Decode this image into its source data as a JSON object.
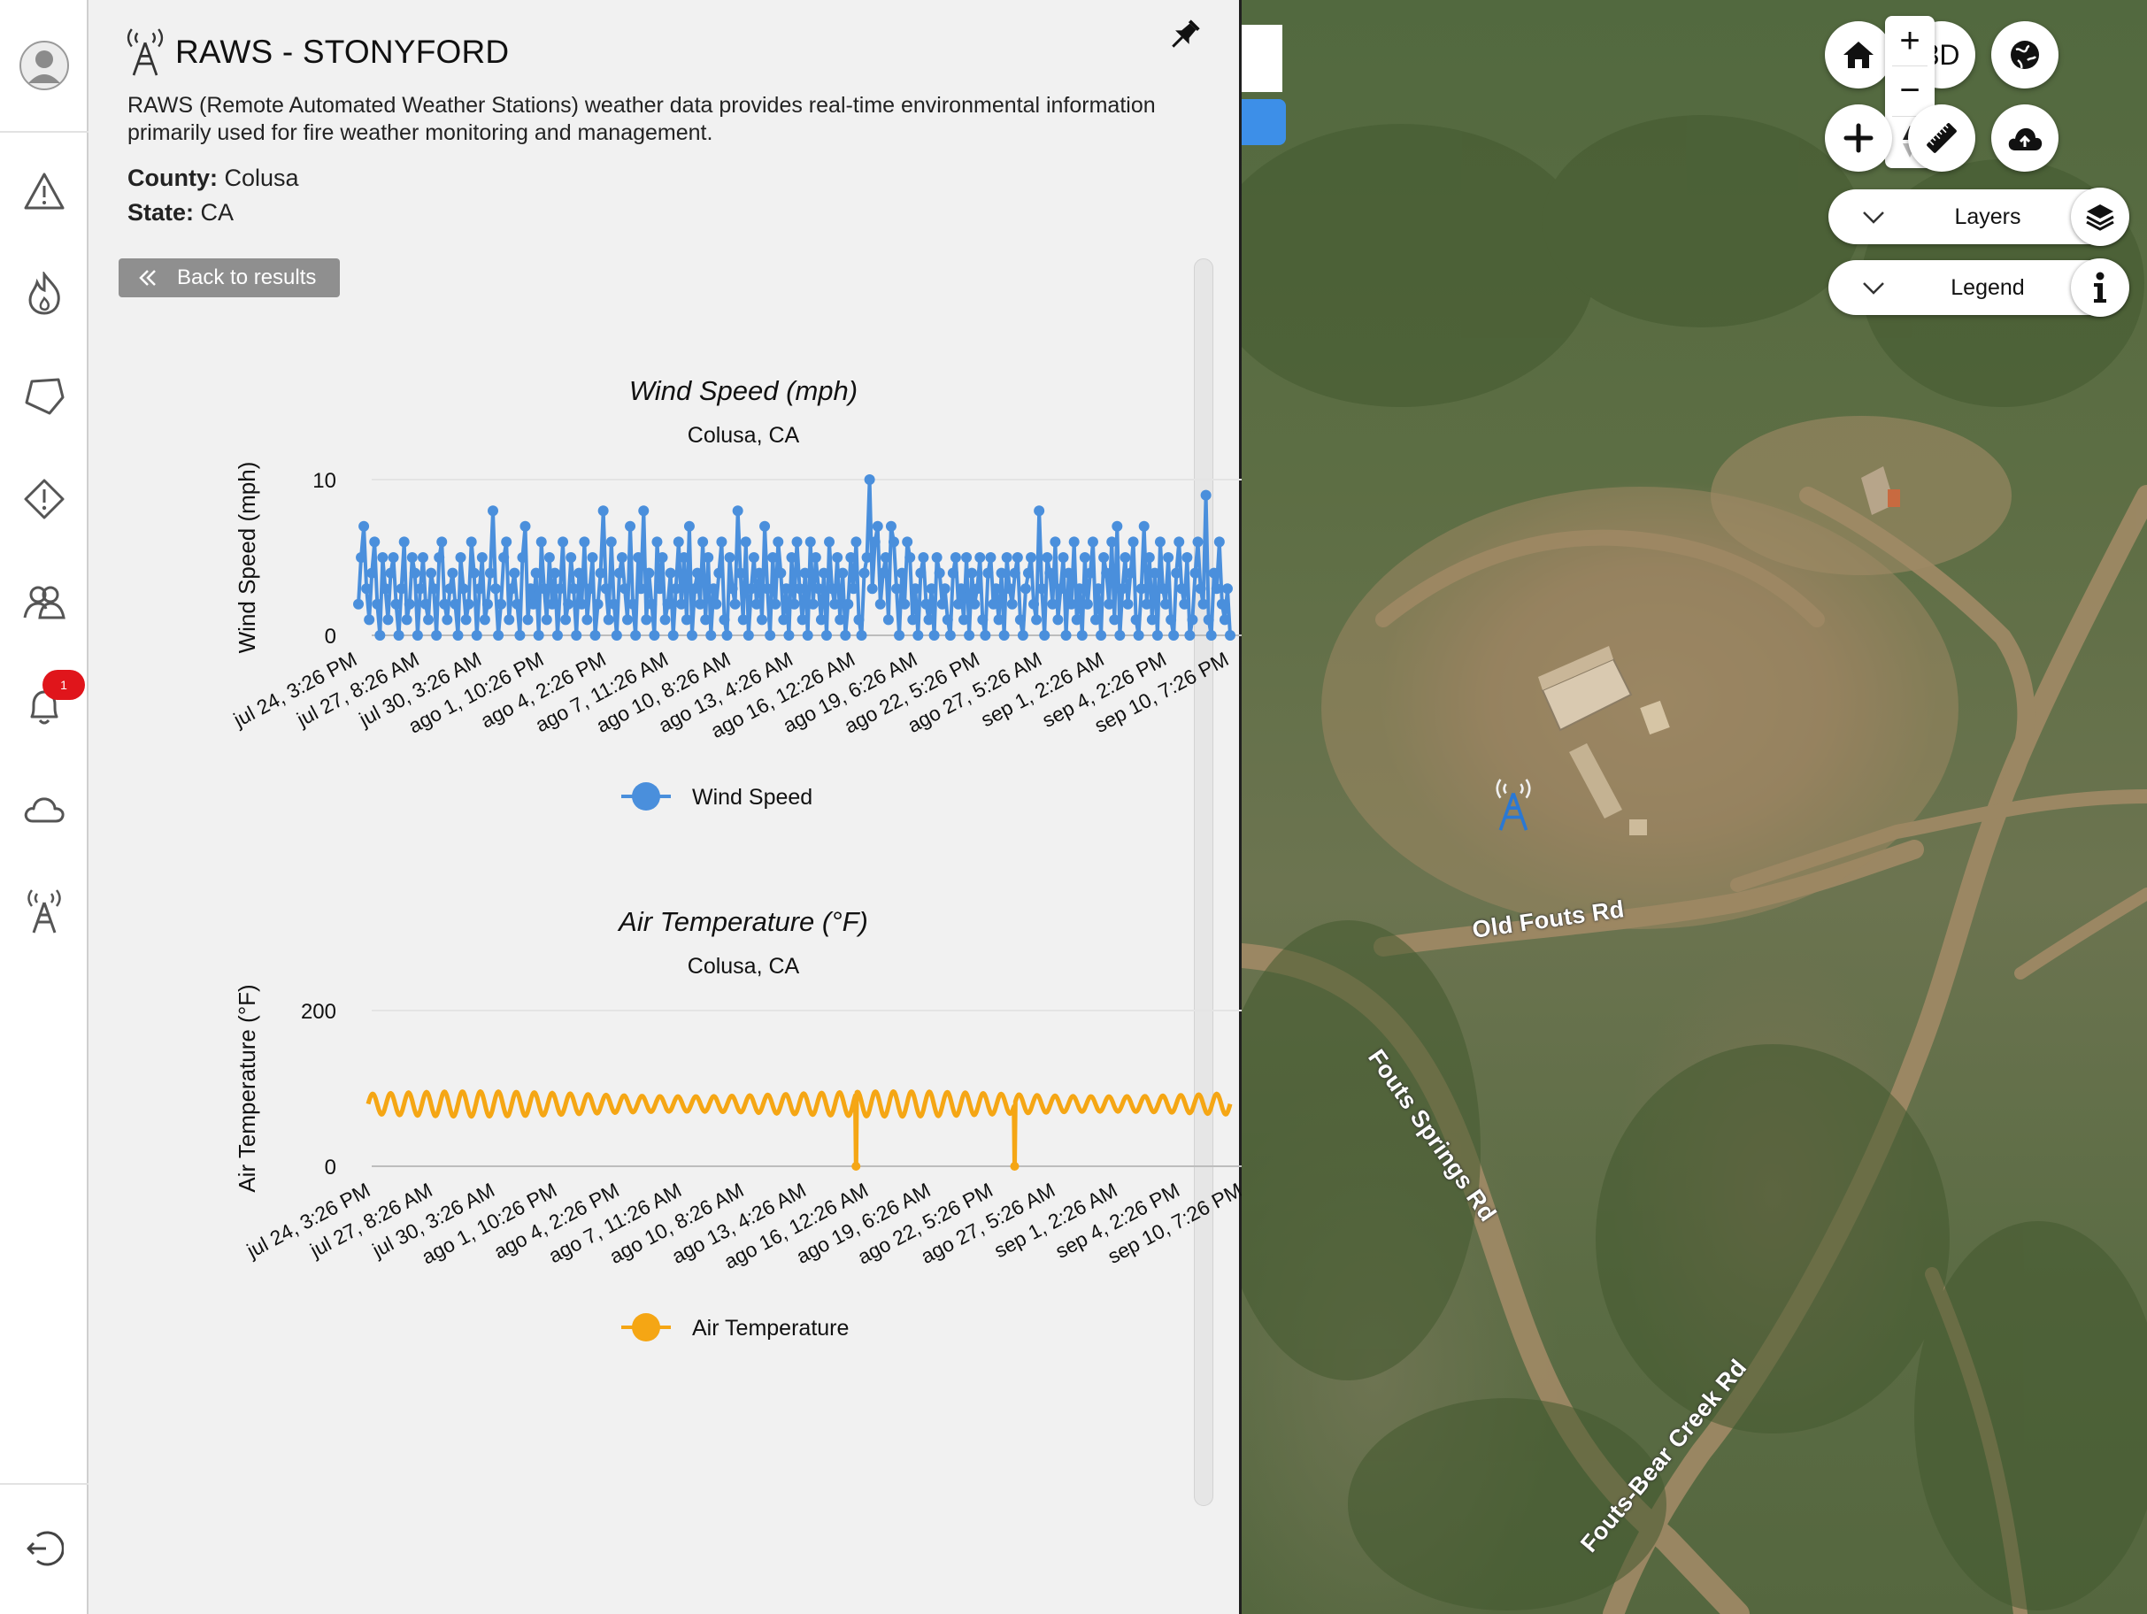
{
  "station": {
    "title": "RAWS - STONYFORD",
    "description": "RAWS (Remote Automated Weather Stations) weather data provides real-time environmental information primarily used for fire weather monitoring and management.",
    "county_label": "County:",
    "county": "Colusa",
    "state_label": "State:",
    "state": "CA",
    "back_label": "Back to results"
  },
  "sidebar": {
    "notification_count": "1",
    "items": [
      "profile-icon",
      "alert-triangle-icon",
      "fire-icon",
      "polygon-icon",
      "warning-diamond-icon",
      "people-icon",
      "bell-icon",
      "cloud-icon",
      "antenna-icon",
      "logout-icon"
    ]
  },
  "map": {
    "buttons": {
      "three_d": "3D",
      "zoom_in": "+",
      "zoom_out": "−"
    },
    "layers_label": "Layers",
    "legend_label": "Legend",
    "roads": [
      "Old Fouts Rd",
      "Fouts Springs Rd",
      "Fouts-Bear Creek Rd"
    ]
  },
  "chart_data": [
    {
      "type": "line",
      "title": "Wind Speed (mph)",
      "subtitle": "Colusa, CA",
      "xlabel": "",
      "ylabel": "Wind Speed (mph)",
      "ylim": [
        0,
        10
      ],
      "yticks": [
        0,
        10
      ],
      "color": "#4a8fdc",
      "x_tick_labels": [
        "jul 24, 3:26 PM",
        "jul 27, 8:26 AM",
        "jul 30, 3:26 AM",
        "ago 1, 10:26 PM",
        "ago 4, 2:26 PM",
        "ago 7, 11:26 AM",
        "ago 10, 8:26 AM",
        "ago 13, 4:26 AM",
        "ago 16, 12:26 AM",
        "ago 19, 6:26 AM",
        "ago 22, 5:26 PM",
        "ago 27, 5:26 AM",
        "sep 1, 2:26 AM",
        "sep 4, 2:26 PM",
        "sep 10, 7:26 PM"
      ],
      "legend": "Wind Speed",
      "series": [
        {
          "name": "Wind Speed",
          "values": [
            2,
            5,
            7,
            3,
            1,
            4,
            6,
            2,
            0,
            5,
            3,
            1,
            4,
            5,
            2,
            0,
            3,
            6,
            1,
            2,
            5,
            4,
            0,
            3,
            5,
            2,
            1,
            4,
            3,
            0,
            5,
            6,
            2,
            1,
            3,
            4,
            2,
            0,
            5,
            3,
            1,
            2,
            6,
            4,
            0,
            3,
            5,
            1,
            2,
            4,
            8,
            3,
            0,
            2,
            5,
            6,
            1,
            3,
            4,
            2,
            0,
            5,
            7,
            1,
            3,
            2,
            4,
            0,
            6,
            3,
            1,
            5,
            2,
            4,
            0,
            3,
            6,
            1,
            2,
            5,
            3,
            0,
            4,
            2,
            6,
            1,
            3,
            5,
            0,
            2,
            4,
            8,
            3,
            1,
            6,
            2,
            0,
            4,
            5,
            3,
            1,
            7,
            2,
            0,
            5,
            3,
            8,
            1,
            4,
            2,
            0,
            6,
            3,
            5,
            1,
            2,
            4,
            0,
            3,
            6,
            2,
            5,
            1,
            7,
            0,
            3,
            4,
            2,
            6,
            1,
            5,
            0,
            3,
            2,
            4,
            6,
            1,
            0,
            5,
            3,
            2,
            8,
            4,
            1,
            6,
            0,
            3,
            5,
            2,
            4,
            1,
            7,
            3,
            0,
            5,
            2,
            6,
            4,
            1,
            3,
            0,
            5,
            2,
            6,
            3,
            1,
            4,
            0,
            6,
            2,
            5,
            3,
            1,
            4,
            0,
            6,
            3,
            2,
            5,
            1,
            4,
            0,
            2,
            5,
            3,
            6,
            1,
            0,
            4,
            5,
            10,
            3,
            6,
            7,
            2,
            4,
            5,
            1,
            7,
            6,
            3,
            0,
            4,
            2,
            6,
            5,
            1,
            3,
            0,
            4,
            5,
            2,
            1,
            3,
            0,
            5,
            4,
            2,
            3,
            1,
            0,
            4,
            5,
            2,
            3,
            1,
            5,
            0,
            4,
            2,
            3,
            5,
            1,
            0,
            4,
            5,
            2,
            3,
            1,
            4,
            0,
            5,
            3,
            2,
            4,
            5,
            1,
            0,
            3,
            4,
            5,
            2,
            1,
            8,
            3,
            0,
            5,
            4,
            2,
            6,
            1,
            3,
            5,
            0,
            4,
            2,
            6,
            1,
            3,
            0,
            5,
            2,
            4,
            6,
            1,
            3,
            0,
            5,
            4,
            2,
            6,
            1,
            7,
            0,
            3,
            5,
            2,
            4,
            6,
            1,
            0,
            3,
            7,
            2,
            5,
            1,
            4,
            0,
            6,
            3,
            2,
            5,
            1,
            0,
            4,
            6,
            3,
            2,
            5,
            0,
            1,
            4,
            6,
            3,
            2,
            9,
            1,
            0,
            4,
            3,
            6,
            2,
            1,
            3,
            0
          ]
        }
      ]
    },
    {
      "type": "line",
      "title": "Air Temperature (°F)",
      "subtitle": "Colusa, CA",
      "xlabel": "",
      "ylabel": "Air Temperature (°F)",
      "ylim": [
        0,
        200
      ],
      "yticks": [
        0,
        200
      ],
      "color": "#f5a614",
      "x_tick_labels": [
        "jul 24, 3:26 PM",
        "jul 27, 8:26 AM",
        "jul 30, 3:26 AM",
        "ago 1, 10:26 PM",
        "ago 4, 2:26 PM",
        "ago 7, 11:26 AM",
        "ago 10, 8:26 AM",
        "ago 13, 4:26 AM",
        "ago 16, 12:26 AM",
        "ago 19, 6:26 AM",
        "ago 22, 5:26 PM",
        "ago 27, 5:26 AM",
        "sep 1, 2:26 AM",
        "sep 4, 2:26 PM",
        "sep 10, 7:26 PM"
      ],
      "legend": "Air Temperature",
      "series": [
        {
          "name": "Air Temperature",
          "days": 48,
          "mean": 80,
          "amplitude": 16,
          "dropouts_fraction": [
            0.566,
            0.75
          ]
        }
      ]
    }
  ]
}
